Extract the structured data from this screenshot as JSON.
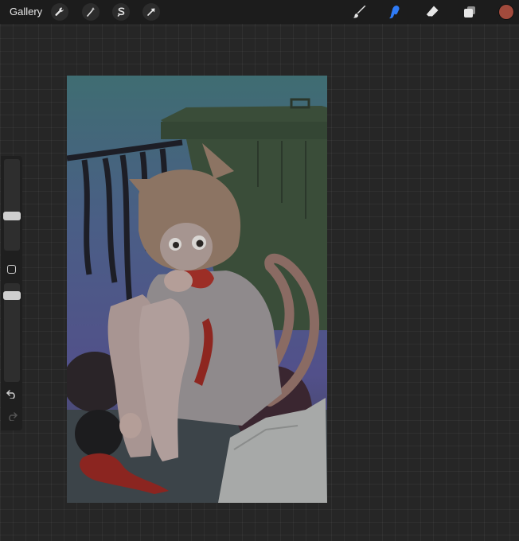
{
  "topbar": {
    "gallery_label": "Gallery",
    "left_tools": [
      "wrench-icon",
      "magic-wand-icon",
      "selection-icon",
      "transform-arrow-icon"
    ],
    "right_tools": [
      "brush-icon",
      "smudge-icon",
      "eraser-icon",
      "layers-icon"
    ],
    "active_tool": "smudge-icon",
    "active_tool_color": "#2f7bf6",
    "current_color": "#a14a3c"
  },
  "sidebar": {
    "brush_size_level": 0.42,
    "opacity_level": 0.3,
    "modify_icon": "square-modify-icon",
    "undo_icon": "undo-icon",
    "redo_icon": "redo-icon"
  },
  "canvas": {
    "content": "illustration"
  }
}
